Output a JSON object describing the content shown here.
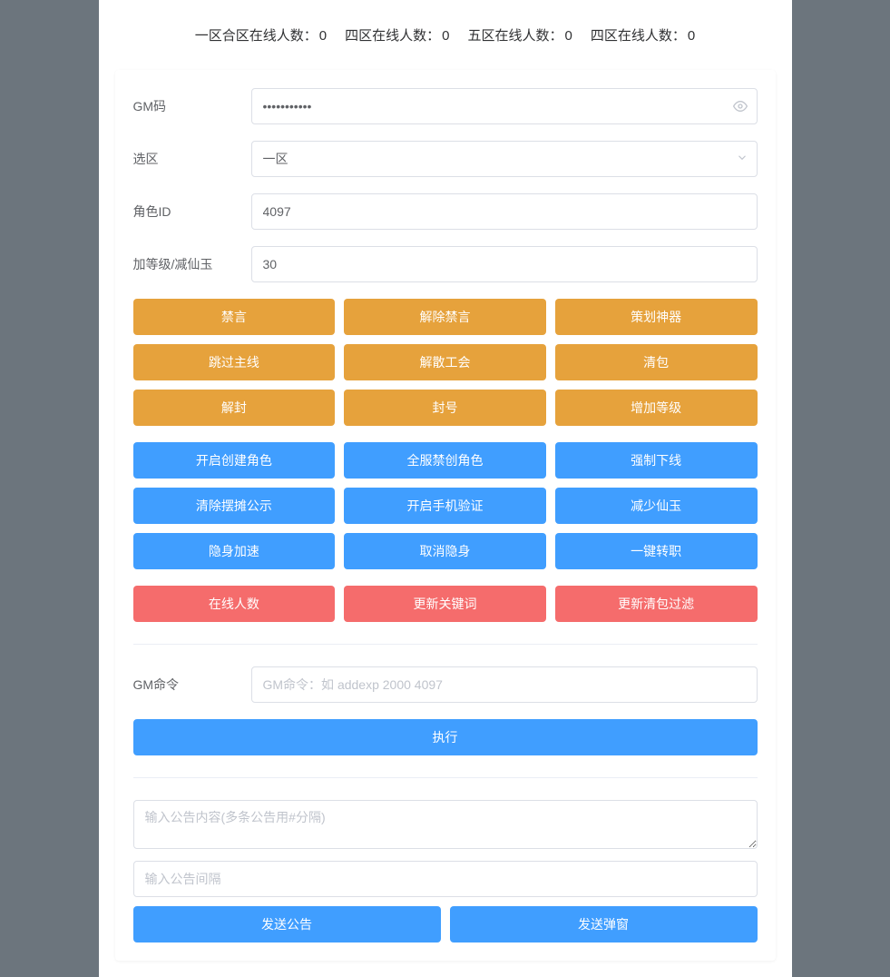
{
  "stats": [
    {
      "label": "一区合区在线人数：",
      "value": "0"
    },
    {
      "label": "四区在线人数：",
      "value": "0"
    },
    {
      "label": "五区在线人数：",
      "value": "0"
    },
    {
      "label": "四区在线人数：",
      "value": "0"
    }
  ],
  "form": {
    "gmcode_label": "GM码",
    "gmcode_value": "xxxxxxxxxxx",
    "zone_label": "选区",
    "zone_selected": "一区",
    "roleid_label": "角色ID",
    "roleid_value": "4097",
    "level_label": "加等级/减仙玉",
    "level_value": "30"
  },
  "buttons_warning": [
    "禁言",
    "解除禁言",
    "策划神器",
    "跳过主线",
    "解散工会",
    "清包",
    "解封",
    "封号",
    "增加等级"
  ],
  "buttons_primary": [
    "开启创建角色",
    "全服禁创角色",
    "强制下线",
    "清除摆摊公示",
    "开启手机验证",
    "减少仙玉",
    "隐身加速",
    "取消隐身",
    "一键转职"
  ],
  "buttons_danger": [
    "在线人数",
    "更新关键词",
    "更新清包过滤"
  ],
  "gmcmd": {
    "label": "GM命令",
    "placeholder": "GM命令：如 addexp 2000 4097",
    "execute": "执行"
  },
  "announce": {
    "content_placeholder": "输入公告内容(多条公告用#分隔)",
    "interval_placeholder": "输入公告间隔",
    "send_announce": "发送公告",
    "send_popup": "发送弹窗"
  }
}
